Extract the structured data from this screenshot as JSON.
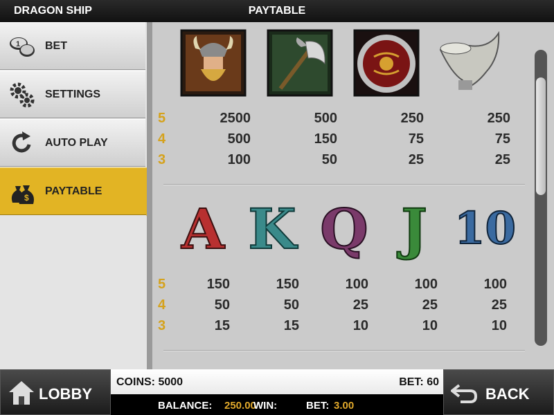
{
  "header": {
    "game_title": "DRAGON SHIP",
    "page_title": "PAYTABLE"
  },
  "sidebar": {
    "items": [
      {
        "label": "BET",
        "icon": "coins-icon"
      },
      {
        "label": "SETTINGS",
        "icon": "gears-icon"
      },
      {
        "label": "AUTO PLAY",
        "icon": "refresh-icon"
      },
      {
        "label": "PAYTABLE",
        "icon": "money-bags-icon",
        "active": true
      }
    ]
  },
  "paytable": {
    "multipliers": [
      "5",
      "4",
      "3"
    ],
    "high_symbols": [
      {
        "name": "viking",
        "icon": "viking-icon",
        "pays": [
          "2500",
          "500",
          "100"
        ]
      },
      {
        "name": "axe",
        "icon": "axe-icon",
        "pays": [
          "500",
          "150",
          "50"
        ]
      },
      {
        "name": "shield",
        "icon": "shield-icon",
        "pays": [
          "250",
          "75",
          "25"
        ]
      },
      {
        "name": "horn",
        "icon": "horn-icon",
        "pays": [
          "250",
          "75",
          "25"
        ]
      }
    ],
    "low_symbols": [
      {
        "name": "A",
        "glyph": "A",
        "color": "#b83030",
        "pays": [
          "150",
          "50",
          "15"
        ]
      },
      {
        "name": "K",
        "glyph": "K",
        "color": "#3a8a8a",
        "pays": [
          "150",
          "50",
          "15"
        ]
      },
      {
        "name": "Q",
        "glyph": "Q",
        "color": "#7a3a6a",
        "pays": [
          "100",
          "25",
          "10"
        ]
      },
      {
        "name": "J",
        "glyph": "J",
        "color": "#3a8a3a",
        "pays": [
          "100",
          "25",
          "10"
        ]
      },
      {
        "name": "10",
        "glyph": "10",
        "color": "#3a6aa0",
        "pays": [
          "100",
          "25",
          "10"
        ]
      }
    ]
  },
  "footer": {
    "lobby_label": "LOBBY",
    "back_label": "BACK",
    "coins_label": "COINS:",
    "coins_value": "5000",
    "bet_label": "BET:",
    "bet_value": "60",
    "balance_label": "BALANCE:",
    "balance_value": "250.00",
    "win_label": "WIN:",
    "bet2_label": "BET:",
    "bet2_value": "3.00"
  },
  "colors": {
    "accent": "#e2b424",
    "multiplier": "#d5a21c"
  }
}
